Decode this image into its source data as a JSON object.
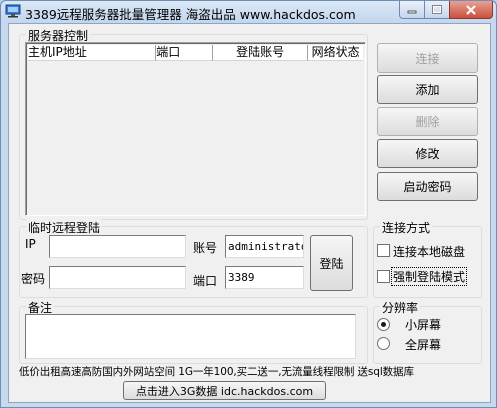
{
  "window": {
    "title": "3389远程服务器批量管理器 海盗出品 www.hackdos.com"
  },
  "server_group": {
    "label": "服务器控制",
    "columns": [
      "主机IP地址",
      "端口",
      "登陆账号",
      "网络状态"
    ]
  },
  "side_buttons": {
    "connect": "连接",
    "add": "添加",
    "delete": "删除",
    "edit": "修改",
    "start_password": "启动密码"
  },
  "temp_login": {
    "label": "临时远程登陆",
    "ip_label": "IP",
    "ip_value": "",
    "account_label": "账号",
    "account_value": "administrator",
    "password_label": "密码",
    "password_value": "",
    "port_label": "端口",
    "port_value": "3389",
    "login_button": "登陆"
  },
  "connect_mode": {
    "label": "连接方式",
    "local_disk": "连接本地磁盘",
    "force_login": "强制登陆模式"
  },
  "notes": {
    "label": "备注"
  },
  "resolution": {
    "label": "分辨率",
    "small": "小屏幕",
    "full": "全屏幕",
    "selected": "小屏幕"
  },
  "footer": {
    "ad_text": "低价出租高速高防国内外网站空间 1G一年100,买二送一,无流量线程限制 送sql数据库",
    "link_button": "点击进入3G数据 idc.hackdos.com"
  }
}
